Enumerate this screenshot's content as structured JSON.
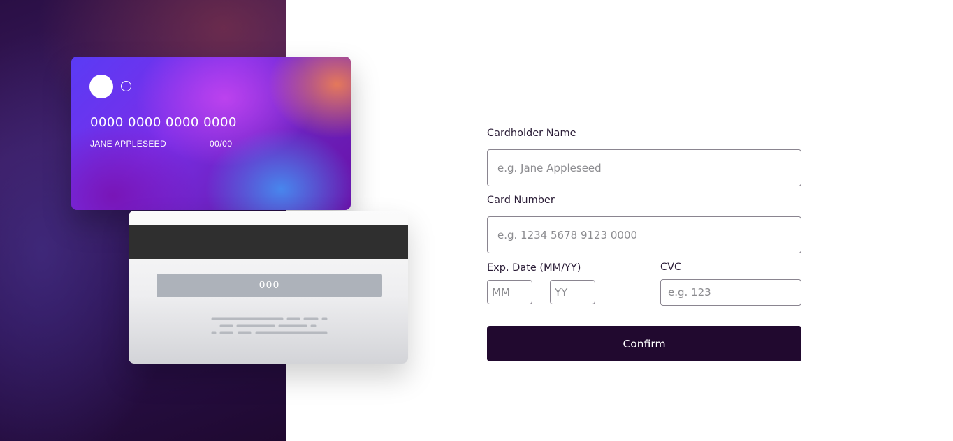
{
  "card_front": {
    "number": "0000 0000 0000 0000",
    "name": "JANE APPLESEED",
    "expiry": "00/00"
  },
  "card_back": {
    "cvc": "000"
  },
  "form": {
    "cardholder_label": "Cardholder Name",
    "cardholder_placeholder": "e.g. Jane Appleseed",
    "card_number_label": "Card Number",
    "card_number_placeholder": "e.g. 1234 5678 9123 0000",
    "exp_label": "Exp. Date (MM/YY)",
    "exp_month_placeholder": "MM",
    "exp_year_placeholder": "YY",
    "cvc_label": "CVC",
    "cvc_placeholder": "e.g. 123",
    "confirm_label": "Confirm"
  },
  "colors": {
    "button": "#21092f",
    "text": "#2a1c36",
    "input_border": "#8a8590"
  }
}
